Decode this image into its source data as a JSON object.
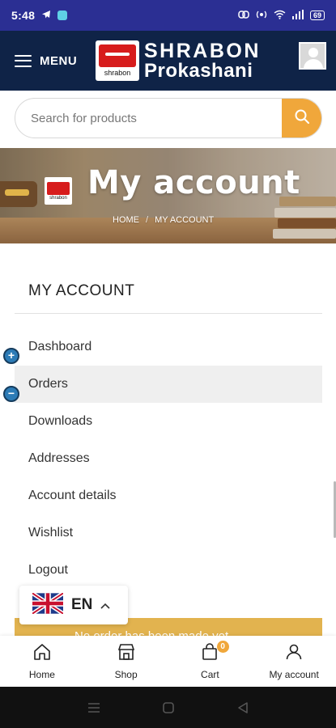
{
  "status_bar": {
    "time": "5:48",
    "battery": "69"
  },
  "header": {
    "menu_label": "MENU",
    "logo_line1": "SHRABON",
    "logo_line2": "Prokashani",
    "logo_badge_text": "shrabon"
  },
  "search": {
    "placeholder": "Search for products"
  },
  "banner": {
    "title": "My account",
    "breadcrumb": [
      "HOME",
      "/",
      "MY ACCOUNT"
    ]
  },
  "account": {
    "heading": "MY ACCOUNT",
    "items": [
      {
        "label": "Dashboard"
      },
      {
        "label": "Orders"
      },
      {
        "label": "Downloads"
      },
      {
        "label": "Addresses"
      },
      {
        "label": "Account details"
      },
      {
        "label": "Wishlist"
      },
      {
        "label": "Logout"
      }
    ],
    "active_item": "Orders"
  },
  "notice": {
    "text": "No order has been made yet."
  },
  "language": {
    "code": "EN"
  },
  "bottom_nav": {
    "items": [
      {
        "label": "Home",
        "icon": "home-icon"
      },
      {
        "label": "Shop",
        "icon": "shop-icon"
      },
      {
        "label": "Cart",
        "icon": "cart-icon",
        "badge": "0"
      },
      {
        "label": "My account",
        "icon": "user-icon"
      }
    ]
  },
  "colors": {
    "status_bar": "#2b2f93",
    "header": "#0f2347",
    "accent": "#f0a73b",
    "notice": "#e2b34f"
  }
}
